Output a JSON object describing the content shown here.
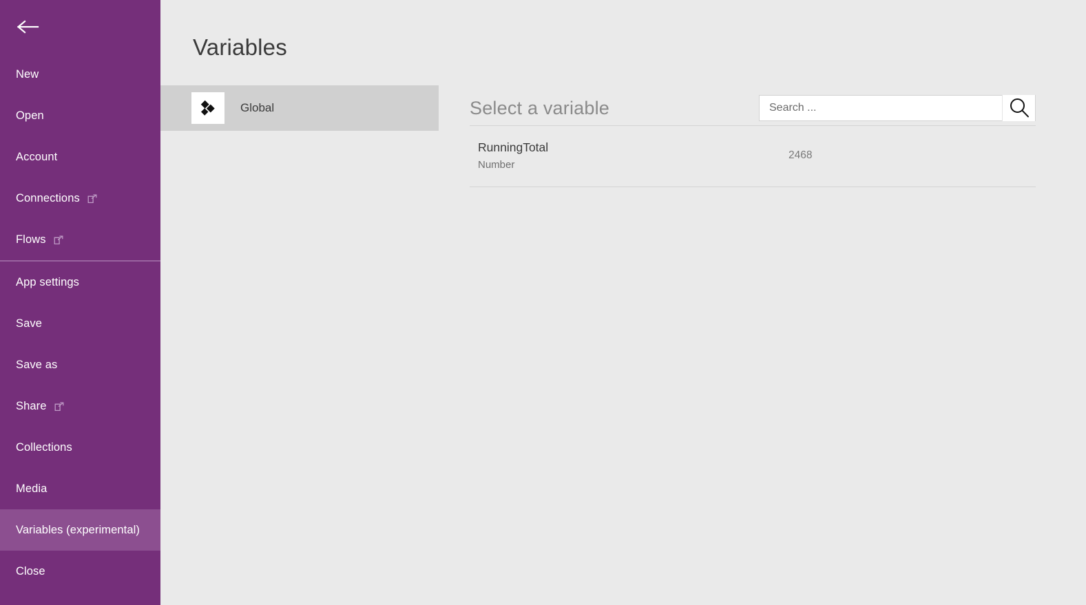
{
  "colors": {
    "sidebar_purple": "#752f7a",
    "sidebar_selected": "#8c4f90",
    "sidebar_separator": "#9a64a0",
    "panel_bg": "#eaeaea",
    "scope_selected": "#d0d0d0",
    "text_dark": "#3a3a3a",
    "text_muted": "#787878"
  },
  "sidebar": {
    "back_icon": "back-arrow-icon",
    "groups": [
      {
        "items": [
          {
            "label": "New",
            "icon": null,
            "selected": false
          },
          {
            "label": "Open",
            "icon": null,
            "selected": false
          },
          {
            "label": "Account",
            "icon": null,
            "selected": false
          },
          {
            "label": "Connections",
            "icon": "external-link-icon",
            "selected": false
          },
          {
            "label": "Flows",
            "icon": "external-link-icon",
            "selected": false
          }
        ]
      },
      {
        "items": [
          {
            "label": "App settings",
            "icon": null,
            "selected": false
          },
          {
            "label": "Save",
            "icon": null,
            "selected": false
          },
          {
            "label": "Save as",
            "icon": null,
            "selected": false
          },
          {
            "label": "Share",
            "icon": "external-link-icon",
            "selected": false
          },
          {
            "label": "Collections",
            "icon": null,
            "selected": false
          },
          {
            "label": "Media",
            "icon": null,
            "selected": false
          },
          {
            "label": "Variables (experimental)",
            "icon": null,
            "selected": true
          },
          {
            "label": "Close",
            "icon": null,
            "selected": false
          }
        ]
      }
    ]
  },
  "variables_panel": {
    "title": "Variables",
    "scopes": [
      {
        "label": "Global",
        "icon": "diamonds-icon",
        "selected": true
      }
    ]
  },
  "main": {
    "header_title": "Select a variable",
    "search": {
      "value": "",
      "placeholder": "Search ...",
      "icon": "search-icon"
    },
    "variables": [
      {
        "name": "RunningTotal",
        "type": "Number",
        "value": "2468"
      }
    ]
  }
}
